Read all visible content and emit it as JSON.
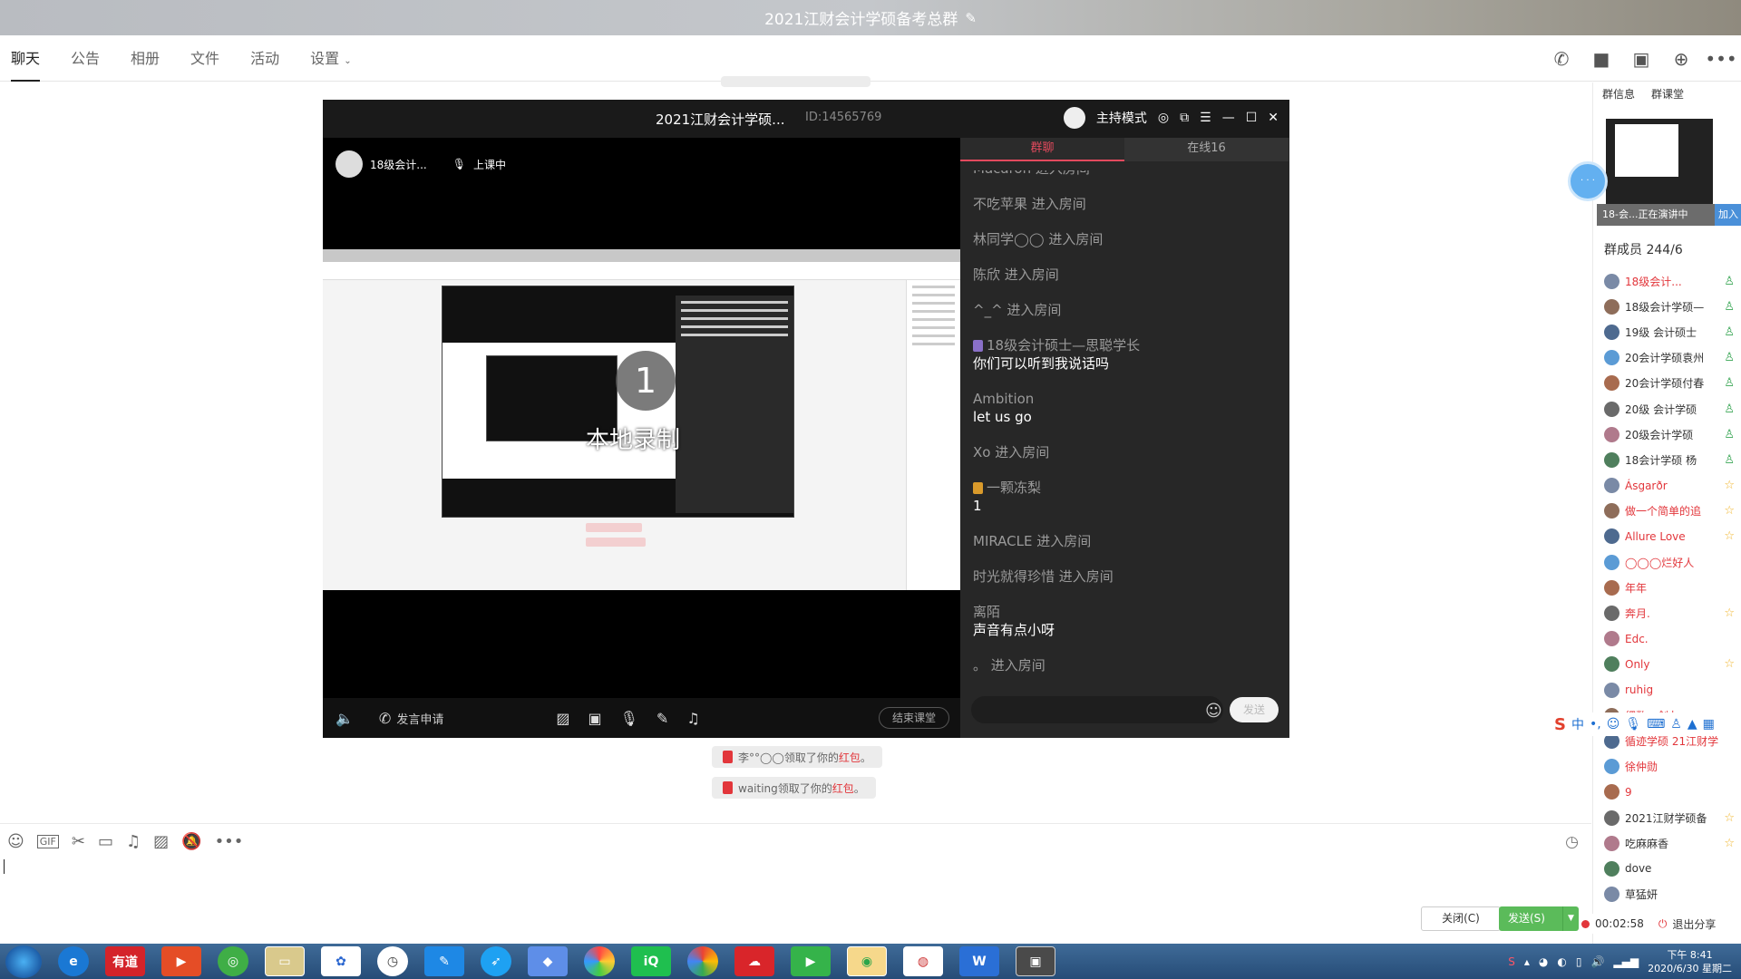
{
  "window": {
    "title": "2021江财会计学硕备考总群"
  },
  "tabs": [
    "聊天",
    "公告",
    "相册",
    "文件",
    "活动",
    "设置"
  ],
  "notices": [
    {
      "prefix": "李°°◯◯领取了你的",
      "red": "红包",
      "suffix": "。"
    },
    {
      "prefix": "waiting领取了你的",
      "red": "红包",
      "suffix": "。"
    }
  ],
  "video": {
    "title": "2021江财会计学硕...",
    "id": "ID:14565769",
    "mode": "主持模式",
    "presenter": "18级会计...",
    "status": "上课中",
    "record_text": "本地录制",
    "record_circle": "1",
    "bottom": {
      "apply": "发言申请",
      "end": "结束课堂"
    },
    "chat_tabs": [
      "群聊",
      "在线16"
    ],
    "messages": [
      {
        "user": "Macaron 进入房间",
        "text": ""
      },
      {
        "user": "不吃苹果 进入房间",
        "text": ""
      },
      {
        "user": "林同学◯◯ 进入房间",
        "text": ""
      },
      {
        "user": "陈欣 进入房间",
        "text": ""
      },
      {
        "user": "^_^ 进入房间",
        "text": ""
      },
      {
        "user": "18级会计硕士—思聪学长",
        "text": "你们可以听到我说话吗",
        "badge": "purple"
      },
      {
        "user": "Ambition",
        "text": "let us go"
      },
      {
        "user": "Xo 进入房间",
        "text": ""
      },
      {
        "user": "一颗冻梨",
        "text": "1",
        "badge": "gold"
      },
      {
        "user": "MIRACLE 进入房间",
        "text": ""
      },
      {
        "user": "时光就得珍惜 进入房间",
        "text": ""
      },
      {
        "user": "离陌",
        "text": "声音有点小呀"
      },
      {
        "user": "。 进入房间",
        "text": ""
      }
    ],
    "send": "发送"
  },
  "input": {
    "close": "关闭(C)",
    "send": "发送(S)"
  },
  "sidebar": {
    "tabs": [
      "群信息",
      "群课堂"
    ],
    "preview_caption": "18-会...正在演讲中",
    "join": "加入",
    "members_label": "群成员 244/6",
    "members": [
      {
        "name": "18级会计...",
        "red": true,
        "tag": "man"
      },
      {
        "name": "18级会计学硕—",
        "red": false,
        "tag": "man"
      },
      {
        "name": "19级 会计硕士",
        "red": false,
        "tag": "man"
      },
      {
        "name": "20会计学硕袁州",
        "red": false,
        "tag": "man"
      },
      {
        "name": "20会计学硕付春",
        "red": false,
        "tag": "man"
      },
      {
        "name": "20级 会计学硕",
        "red": false,
        "tag": "man"
      },
      {
        "name": "20级会计学硕",
        "red": false,
        "tag": "man"
      },
      {
        "name": "18会计学硕 杨",
        "red": false,
        "tag": "man"
      },
      {
        "name": "Ásgarðr",
        "red": true,
        "tag": "star"
      },
      {
        "name": "做一个简单的追",
        "red": true,
        "tag": "star"
      },
      {
        "name": "Allure Love",
        "red": true,
        "tag": "star"
      },
      {
        "name": "◯◯◯烂好人",
        "red": true,
        "tag": ""
      },
      {
        "name": "年年",
        "red": true,
        "tag": ""
      },
      {
        "name": "奔月.",
        "red": true,
        "tag": "star"
      },
      {
        "name": "Edc.",
        "red": true,
        "tag": ""
      },
      {
        "name": "Only",
        "red": true,
        "tag": "star"
      },
      {
        "name": "ruhig",
        "red": true,
        "tag": ""
      },
      {
        "name": "细数一剑九",
        "red": true,
        "tag": ""
      },
      {
        "name": "循迹学硕 21江财学",
        "red": true,
        "tag": ""
      },
      {
        "name": "徐仲勋",
        "red": true,
        "tag": ""
      },
      {
        "name": "9",
        "red": true,
        "tag": ""
      },
      {
        "name": "2021江财学硕备",
        "red": false,
        "tag": "star"
      },
      {
        "name": "吃麻麻香",
        "red": false,
        "tag": "star"
      },
      {
        "name": "dove",
        "red": false,
        "tag": ""
      },
      {
        "name": "草猛妍",
        "red": false,
        "tag": ""
      }
    ],
    "recording": {
      "time": "00:02:58",
      "exit": "退出分享"
    }
  },
  "ime": {
    "label": "中"
  },
  "taskbar": {
    "apps": [
      "有道",
      "W"
    ],
    "time": "下午 8:41",
    "date": "2020/6/30 星期二"
  },
  "colors": {
    "accent_red": "#e2363b",
    "green": "#5bbb5a",
    "chat_bg": "#272727"
  }
}
